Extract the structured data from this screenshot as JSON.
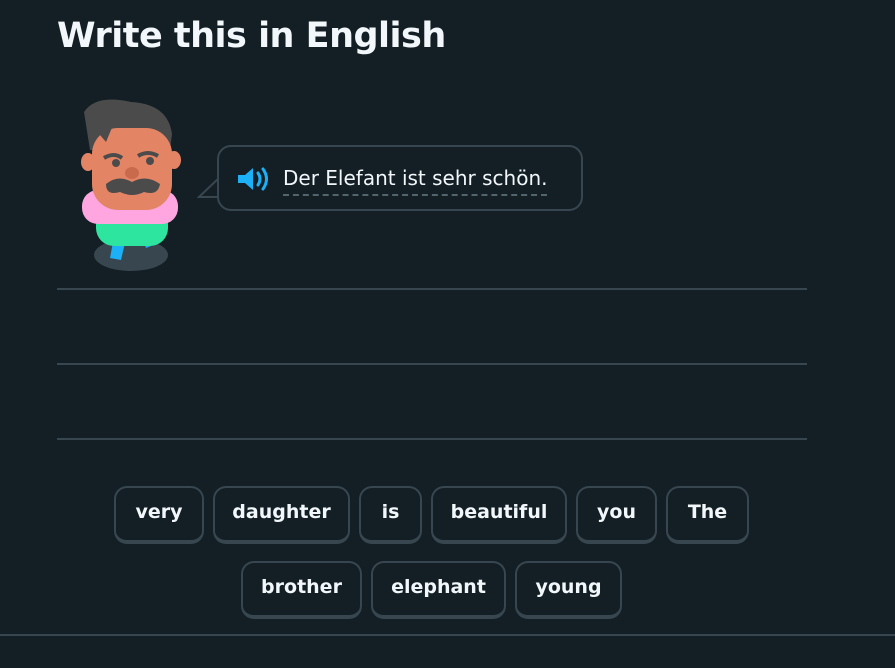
{
  "header": {
    "title": "Write this in English"
  },
  "prompt": {
    "text": "Der Elefant ist sehr schön.",
    "audio_icon": "speaker-icon"
  },
  "word_bank": {
    "words": [
      "very",
      "daughter",
      "is",
      "beautiful",
      "you",
      "The",
      "brother",
      "elephant",
      "young"
    ]
  },
  "colors": {
    "background": "#131f24",
    "border": "#37464f",
    "text": "#f1f7fb",
    "speaker": "#1cb0f6"
  }
}
